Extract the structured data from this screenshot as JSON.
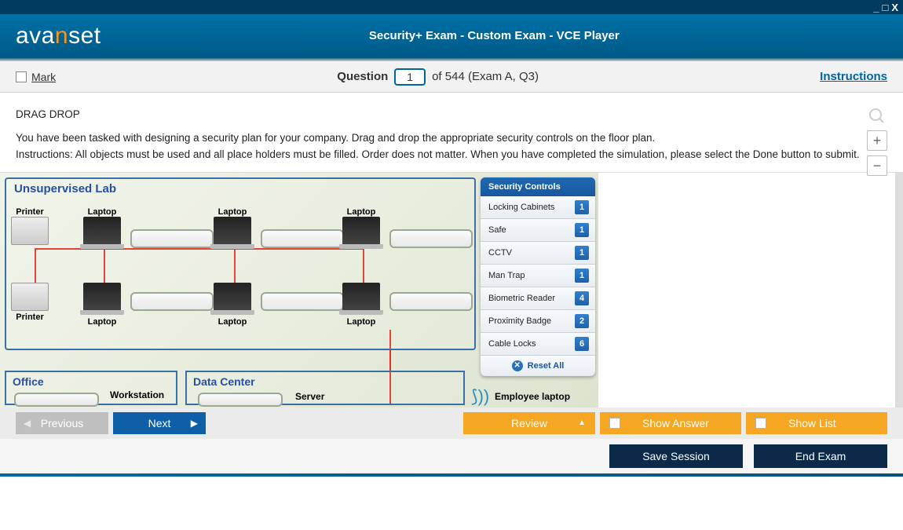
{
  "window": {
    "minimize": "_",
    "maximize": "□",
    "close": "X"
  },
  "header": {
    "logo_part1": "ava",
    "logo_accent": "n",
    "logo_part2": "set",
    "title": "Security+ Exam - Custom Exam - VCE Player"
  },
  "questionBar": {
    "mark": "Mark",
    "question_label": "Question",
    "current": "1",
    "total_text": "of 544 (Exam A, Q3)",
    "instructions": "Instructions"
  },
  "questionText": {
    "heading": "DRAG DROP",
    "line1": "You have been tasked with designing a security plan for your company. Drag and drop the appropriate security controls on the floor plan.",
    "line2": "Instructions: All objects must be used and all place holders must be filled. Order does not matter. When you have completed the simulation, please select the Done button to submit."
  },
  "zoom": {
    "plus": "+",
    "minus": "−"
  },
  "floorPlan": {
    "lab_title": "Unsupervised Lab",
    "printer": "Printer",
    "laptop": "Laptop",
    "office": "Office",
    "workstation": "Workstation",
    "data_center": "Data Center",
    "server": "Server",
    "employee_laptop": "Employee laptop"
  },
  "securityPanel": {
    "header": "Security Controls",
    "items": [
      {
        "label": "Locking Cabinets",
        "count": "1"
      },
      {
        "label": "Safe",
        "count": "1"
      },
      {
        "label": "CCTV",
        "count": "1"
      },
      {
        "label": "Man Trap",
        "count": "1"
      },
      {
        "label": "Biometric Reader",
        "count": "4"
      },
      {
        "label": "Proximity Badge",
        "count": "2"
      },
      {
        "label": "Cable Locks",
        "count": "6"
      }
    ],
    "reset": "Reset All"
  },
  "bottomBar": {
    "previous": "Previous",
    "next": "Next",
    "review": "Review",
    "show_answer": "Show Answer",
    "show_list": "Show List"
  },
  "actionBar": {
    "save_session": "Save Session",
    "end_exam": "End Exam"
  }
}
